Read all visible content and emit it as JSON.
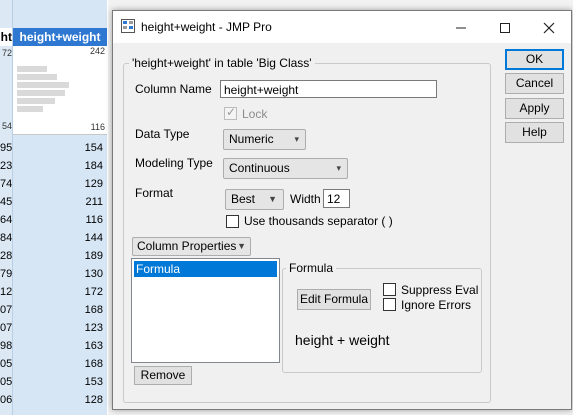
{
  "background_table": {
    "left_col_header": "ht",
    "main_col_header": "height+weight",
    "hist_max": "242",
    "hist_min": "116",
    "left_hist_top": "72",
    "left_hist_bottom": "54",
    "left_values": [
      "95",
      "23",
      "74",
      "45",
      "64",
      "84",
      "28",
      "79",
      "12",
      "07",
      "07",
      "98",
      "05",
      "05",
      "06"
    ],
    "main_values": [
      "154",
      "184",
      "129",
      "211",
      "116",
      "144",
      "189",
      "130",
      "172",
      "168",
      "123",
      "163",
      "168",
      "153",
      "128"
    ]
  },
  "dialog": {
    "title": "height+weight - JMP Pro",
    "buttons": {
      "ok": "OK",
      "cancel": "Cancel",
      "apply": "Apply",
      "help": "Help"
    },
    "group_title": "'height+weight' in table 'Big Class'",
    "column_name_label": "Column Name",
    "column_name_value": "height+weight",
    "lock_label": "Lock",
    "data_type_label": "Data Type",
    "data_type_value": "Numeric",
    "modeling_type_label": "Modeling Type",
    "modeling_type_value": "Continuous",
    "format_label": "Format",
    "format_value": "Best",
    "width_label": "Width",
    "width_value": "12",
    "thousands_label": "Use thousands separator ( )",
    "column_properties_label": "Column Properties",
    "property_list": [
      "Formula"
    ],
    "remove_label": "Remove",
    "formula_group_title": "Formula",
    "edit_formula_label": "Edit Formula",
    "suppress_eval_label": "Suppress Eval",
    "ignore_errors_label": "Ignore Errors",
    "formula_expression": "height + weight"
  },
  "colors": {
    "accent": "#0078d7",
    "header_blue": "#2e78d2",
    "row_highlight": "#d6e6f5"
  },
  "icons": {
    "app": "jmp-app-icon",
    "minimize": "minimize-icon",
    "maximize": "maximize-icon",
    "close": "close-icon"
  }
}
